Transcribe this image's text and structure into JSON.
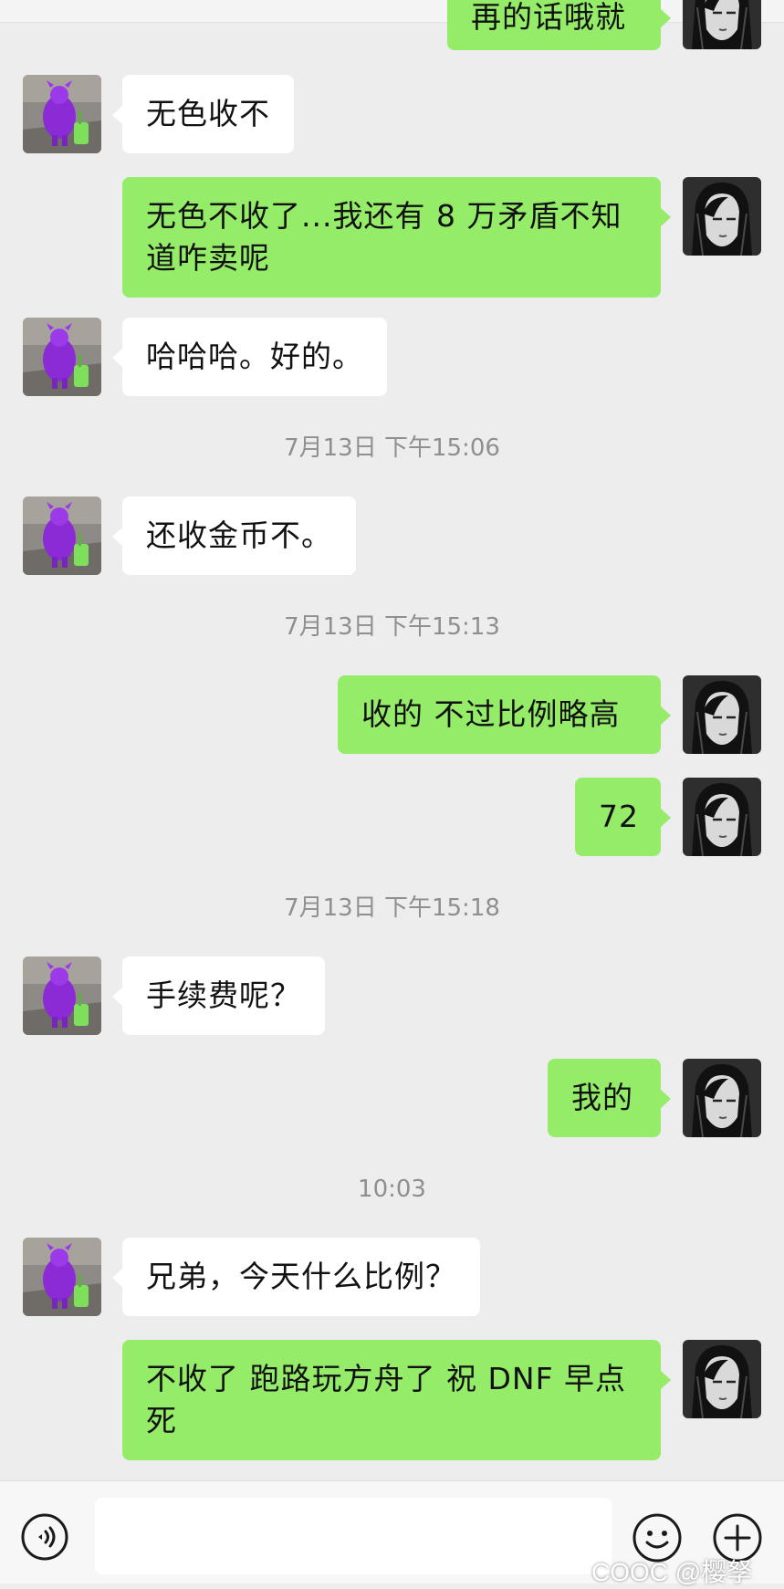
{
  "colors": {
    "background": "#ededed",
    "incoming_bubble": "#ffffff",
    "outgoing_bubble": "#95ec69",
    "timestamp_text": "#8f8f8f"
  },
  "messages": [
    {
      "side": "out",
      "text": "再的话哦就"
    },
    {
      "side": "in",
      "text": "无色收不"
    },
    {
      "side": "out",
      "text": "无色不收了...我还有 8 万矛盾不知道咋卖呢"
    },
    {
      "side": "in",
      "text": "哈哈哈。好的。"
    },
    {
      "side": "in",
      "text": "还收金币不。"
    },
    {
      "side": "out",
      "text": "收的 不过比例略高"
    },
    {
      "side": "out",
      "text": "72"
    },
    {
      "side": "in",
      "text": "手续费呢？"
    },
    {
      "side": "out",
      "text": "我的"
    },
    {
      "side": "in",
      "text": "兄弟，今天什么比例？"
    },
    {
      "side": "out",
      "text": "不收了 跑路玩方舟了  祝 DNF 早点死"
    }
  ],
  "timestamps": [
    "7月13日 下午15:06",
    "7月13日 下午15:13",
    "7月13日 下午15:18",
    "10:03"
  ],
  "input_bar": {
    "icons": [
      "voice-icon",
      "emoji-icon",
      "plus-icon"
    ],
    "watermark": "COOC @樱孥"
  }
}
